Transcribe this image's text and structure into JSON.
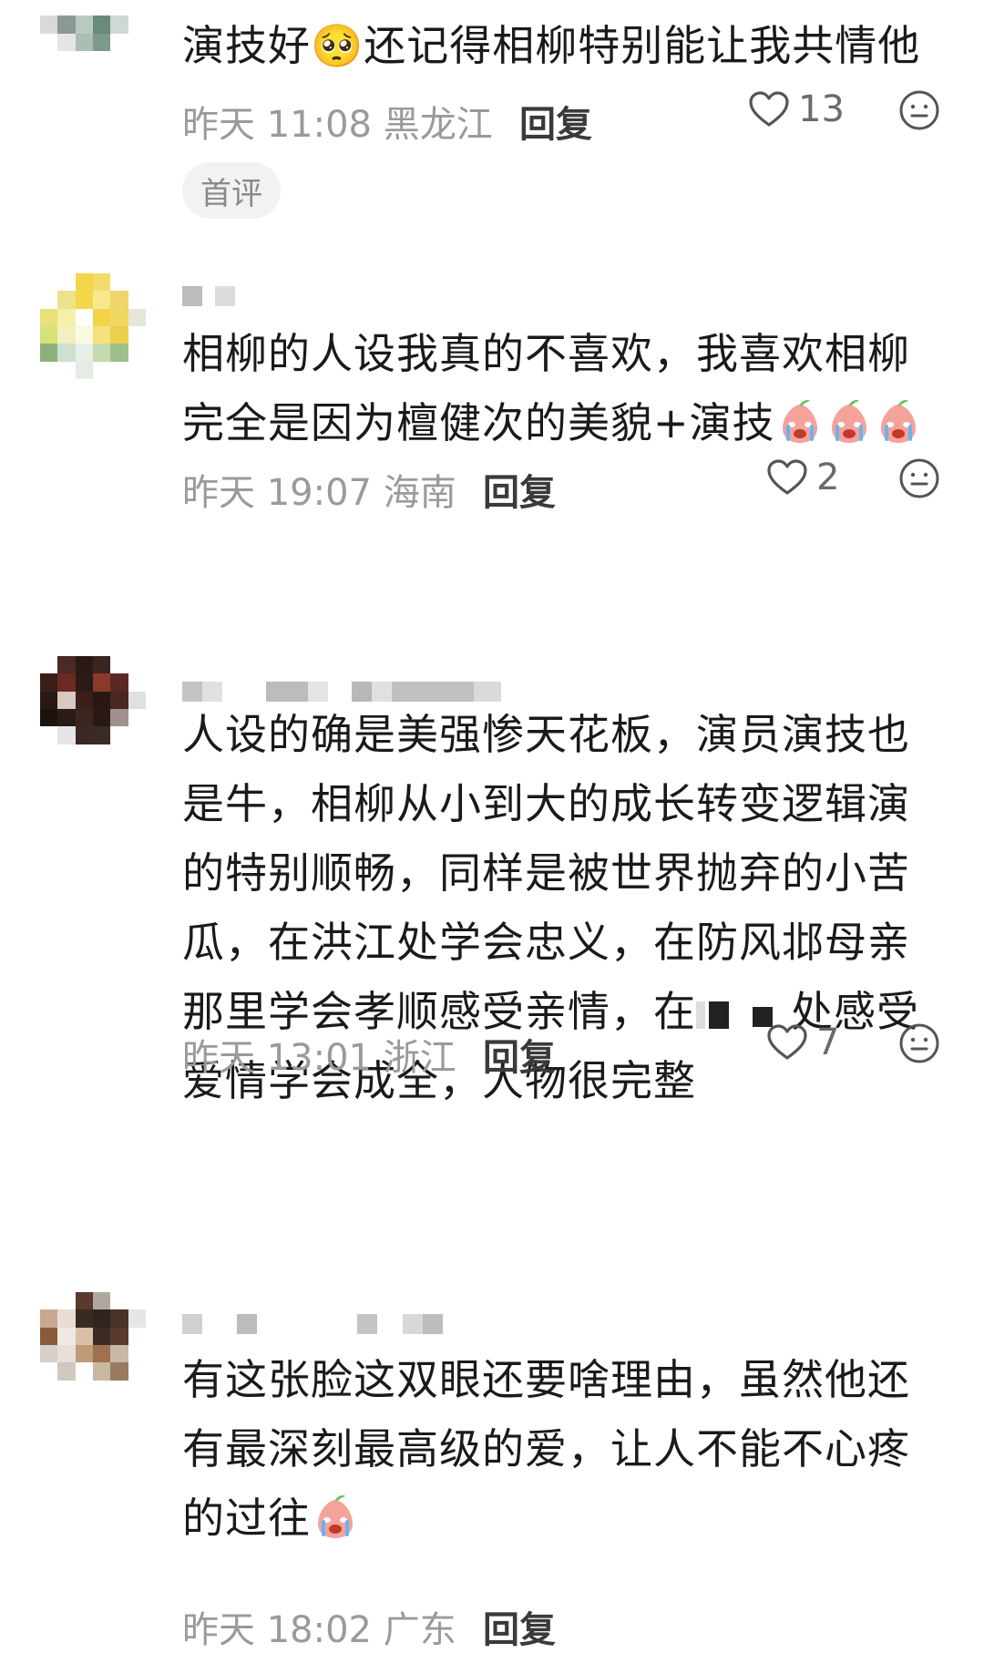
{
  "comments": [
    {
      "text": "演技好🥺还记得相柳特别能让我共情他",
      "time": "昨天 11:08 黑龙江",
      "reply": "回复",
      "likes": "13",
      "badge": "首评"
    },
    {
      "text_line1": "相柳的人设我真的不喜欢，我喜欢相柳",
      "text_line2": "完全是因为檀健次的美貌+演技",
      "time": "昨天 19:07 海南",
      "reply": "回复",
      "likes": "2"
    },
    {
      "text": "人设的确是美强惨天花板，演员演技也是牛，相柳从小到大的成长转变逻辑演的特别顺畅，同样是被世界抛弃的小苦瓜，在洪江处学会忠义，在防风邶母亲那里学会孝顺感受亲情，在",
      "text_after": "处感受爱情学会成全，人物很完整",
      "time": "昨天 13:01 浙江",
      "reply": "回复",
      "likes": "7"
    },
    {
      "text": "有这张脸这双眼还要啥理由，虽然他还有最深刻最高级的爱，让人不能不心疼的过往",
      "time": "昨天 18:02 广东",
      "reply": "回复"
    }
  ],
  "icons": {
    "like": "heart-outline-icon",
    "emoji": "smile-face-icon",
    "sticker": "crying-peach-emoji"
  },
  "colors": {
    "meta": "#9a9a9a",
    "reply": "#3a3a3a",
    "badge_bg": "#f2f2f2"
  }
}
